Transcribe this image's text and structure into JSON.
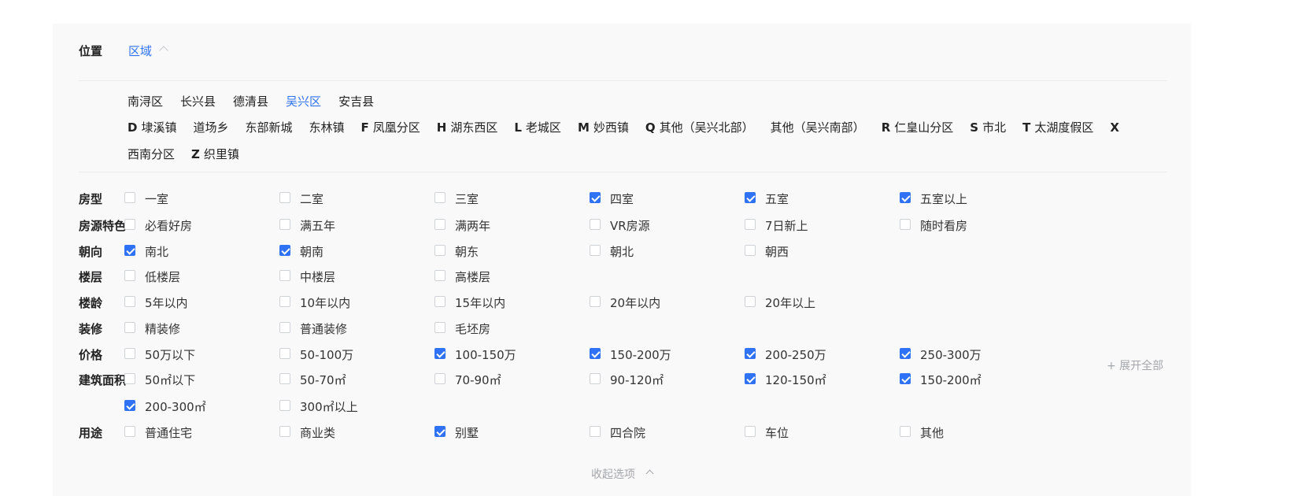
{
  "location": {
    "label": "位置",
    "tab": "区域",
    "districts": [
      {
        "label": "南浔区",
        "selected": false
      },
      {
        "label": "长兴县",
        "selected": false
      },
      {
        "label": "德清县",
        "selected": false
      },
      {
        "label": "吴兴区",
        "selected": true
      },
      {
        "label": "安吉县",
        "selected": false
      }
    ],
    "towns_row1": [
      {
        "letter": "D",
        "items": [
          "埭溪镇",
          "道场乡",
          "东部新城",
          "东林镇"
        ]
      },
      {
        "letter": "F",
        "items": [
          "凤凰分区"
        ]
      },
      {
        "letter": "H",
        "items": [
          "湖东西区"
        ]
      },
      {
        "letter": "L",
        "items": [
          "老城区"
        ]
      },
      {
        "letter": "M",
        "items": [
          "妙西镇"
        ]
      },
      {
        "letter": "Q",
        "items": [
          "其他（吴兴北部）",
          "其他（吴兴南部）"
        ]
      },
      {
        "letter": "R",
        "items": [
          "仁皇山分区"
        ]
      },
      {
        "letter": "S",
        "items": [
          "市北"
        ]
      },
      {
        "letter": "T",
        "items": [
          "太湖度假区"
        ]
      },
      {
        "letter": "X",
        "items": []
      }
    ],
    "towns_row2": [
      {
        "letter": "",
        "items": [
          "西南分区"
        ]
      },
      {
        "letter": "Z",
        "items": [
          "织里镇"
        ]
      }
    ]
  },
  "filters": [
    {
      "label": "房型",
      "options": [
        {
          "label": "一室",
          "checked": false
        },
        {
          "label": "二室",
          "checked": false
        },
        {
          "label": "三室",
          "checked": false
        },
        {
          "label": "四室",
          "checked": true
        },
        {
          "label": "五室",
          "checked": true
        },
        {
          "label": "五室以上",
          "checked": true
        }
      ]
    },
    {
      "label": "房源特色",
      "options": [
        {
          "label": "必看好房",
          "checked": false
        },
        {
          "label": "满五年",
          "checked": false
        },
        {
          "label": "满两年",
          "checked": false
        },
        {
          "label": "VR房源",
          "checked": false
        },
        {
          "label": "7日新上",
          "checked": false
        },
        {
          "label": "随时看房",
          "checked": false
        }
      ]
    },
    {
      "label": "朝向",
      "options": [
        {
          "label": "南北",
          "checked": true
        },
        {
          "label": "朝南",
          "checked": true
        },
        {
          "label": "朝东",
          "checked": false
        },
        {
          "label": "朝北",
          "checked": false
        },
        {
          "label": "朝西",
          "checked": false
        }
      ]
    },
    {
      "label": "楼层",
      "options": [
        {
          "label": "低楼层",
          "checked": false
        },
        {
          "label": "中楼层",
          "checked": false
        },
        {
          "label": "高楼层",
          "checked": false
        }
      ]
    },
    {
      "label": "楼龄",
      "options": [
        {
          "label": "5年以内",
          "checked": false
        },
        {
          "label": "10年以内",
          "checked": false
        },
        {
          "label": "15年以内",
          "checked": false
        },
        {
          "label": "20年以内",
          "checked": false
        },
        {
          "label": "20年以上",
          "checked": false
        }
      ]
    },
    {
      "label": "装修",
      "options": [
        {
          "label": "精装修",
          "checked": false
        },
        {
          "label": "普通装修",
          "checked": false
        },
        {
          "label": "毛坯房",
          "checked": false
        }
      ]
    },
    {
      "label": "价格",
      "options": [
        {
          "label": "50万以下",
          "checked": false
        },
        {
          "label": "50-100万",
          "checked": false
        },
        {
          "label": "100-150万",
          "checked": true
        },
        {
          "label": "150-200万",
          "checked": true
        },
        {
          "label": "200-250万",
          "checked": true
        },
        {
          "label": "250-300万",
          "checked": true
        }
      ]
    },
    {
      "label": "建筑面积",
      "options": [
        {
          "label": "50㎡以下",
          "checked": false
        },
        {
          "label": "50-70㎡",
          "checked": false
        },
        {
          "label": "70-90㎡",
          "checked": false
        },
        {
          "label": "90-120㎡",
          "checked": false
        },
        {
          "label": "120-150㎡",
          "checked": true
        },
        {
          "label": "150-200㎡",
          "checked": true
        },
        {
          "label": "200-300㎡",
          "checked": true
        },
        {
          "label": "300㎡以上",
          "checked": false
        }
      ]
    },
    {
      "label": "用途",
      "options": [
        {
          "label": "普通住宅",
          "checked": false
        },
        {
          "label": "商业类",
          "checked": false
        },
        {
          "label": "别墅",
          "checked": true
        },
        {
          "label": "四合院",
          "checked": false
        },
        {
          "label": "车位",
          "checked": false
        },
        {
          "label": "其他",
          "checked": false
        }
      ]
    }
  ],
  "expand_all_label": "+ 展开全部",
  "collapse_label": "收起选项",
  "colors": {
    "accent": "#3072f6",
    "muted": "#a3a6ab",
    "panel": "#f9f9fa"
  }
}
